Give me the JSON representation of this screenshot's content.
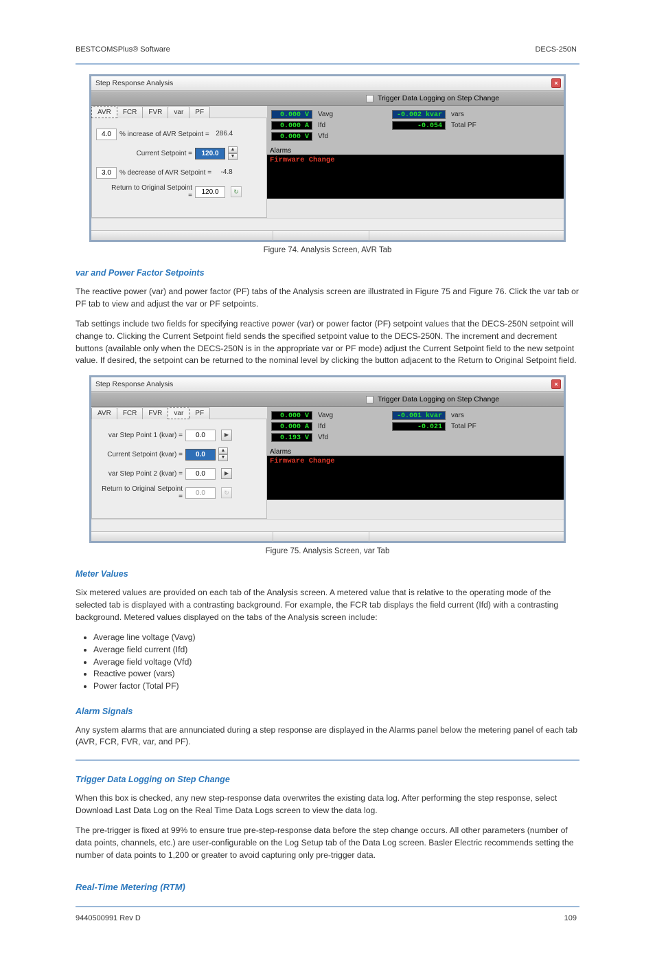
{
  "header": {
    "left": "BESTCOMSPlus® Software",
    "right": "DECS-250N"
  },
  "footer": {
    "left": "9440500991 Rev D",
    "right": "109"
  },
  "screenshot1": {
    "title": "Step Response Analysis",
    "trigger_label": "Trigger Data Logging on Step Change",
    "tabs": [
      "AVR",
      "FCR",
      "FVR",
      "var",
      "PF"
    ],
    "active_tab": "AVR",
    "row1": {
      "box": "4.0",
      "label": "% increase of AVR Setpoint =",
      "value": "286.4"
    },
    "row2": {
      "label": "Current Setpoint =",
      "value": "120.0"
    },
    "row3": {
      "box": "3.0",
      "label": "% decrease of AVR Setpoint =",
      "value": "-4.8"
    },
    "row4": {
      "label": "Return to Original Setpoint =",
      "value": "120.0"
    },
    "meters": {
      "vavg": {
        "val": "0.000 V",
        "lbl": "Vavg"
      },
      "ifd": {
        "val": "0.000 A",
        "lbl": "Ifd"
      },
      "vfd": {
        "val": "0.000 V",
        "lbl": "Vfd"
      },
      "vars": {
        "val": "-0.002 kvar",
        "lbl": "vars"
      },
      "pf": {
        "val": "-0.054",
        "lbl": "Total PF"
      }
    },
    "alarms_title": "Alarms",
    "alarm_text": "Firmware Change"
  },
  "caption1": "Figure 74. Analysis Screen, AVR Tab",
  "heading_setpoints": "var and Power Factor Setpoints",
  "para_setpoints_1": "The reactive power (var) and power factor (PF) tabs of the Analysis screen are illustrated in Figure 75 and Figure 76. Click the var tab or PF tab to view and adjust the var or PF setpoints.",
  "para_setpoints_2": "Tab settings include two fields for specifying reactive power (var) or power factor (PF) setpoint values that the DECS-250N setpoint will change to. Clicking the Current Setpoint field sends the specified setpoint value to the DECS-250N. The increment and decrement buttons (available only when the DECS-250N is in the appropriate var or PF mode) adjust the Current Setpoint field to the new setpoint value. If desired, the setpoint can be returned to the nominal level by clicking the button adjacent to the Return to Original Setpoint field.",
  "screenshot2": {
    "title": "Step Response Analysis",
    "trigger_label": "Trigger Data Logging on Step Change",
    "tabs": [
      "AVR",
      "FCR",
      "FVR",
      "var",
      "PF"
    ],
    "active_tab": "var",
    "row1": {
      "label": "var Step Point 1 (kvar) =",
      "value": "0.0"
    },
    "row2": {
      "label": "Current Setpoint (kvar) =",
      "value": "0.0"
    },
    "row3": {
      "label": "var Step Point 2 (kvar) =",
      "value": "0.0"
    },
    "row4": {
      "label": "Return to Original Setpoint =",
      "value": "0.0"
    },
    "meters": {
      "vavg": {
        "val": "0.000 V",
        "lbl": "Vavg"
      },
      "ifd": {
        "val": "0.000 A",
        "lbl": "Ifd"
      },
      "vfd": {
        "val": "0.193 V",
        "lbl": "Vfd"
      },
      "vars": {
        "val": "-0.001 kvar",
        "lbl": "vars"
      },
      "pf": {
        "val": "-0.021",
        "lbl": "Total PF"
      }
    },
    "alarms_title": "Alarms",
    "alarm_text": "Firmware Change"
  },
  "caption2": "Figure 75. Analysis Screen, var Tab",
  "heading_meter": "Meter Values",
  "para_meter": "Six metered values are provided on each tab of the Analysis screen. A metered value that is relative to the operating mode of the selected tab is displayed with a contrasting background. For example, the FCR tab displays the field current (Ifd) with a contrasting background. Metered values displayed on the tabs of the Analysis screen include:",
  "bullets": [
    "Average line voltage (Vavg)",
    "Average field current (Ifd)",
    "Average field voltage (Vfd)",
    "Reactive power (vars)",
    "Power factor (Total PF)"
  ],
  "heading_alarms": "Alarm Signals",
  "para_alarms": "Any system alarms that are annunciated during a step response are displayed in the Alarms panel below the metering panel of each tab (AVR, FCR, FVR, var, and PF).",
  "heading_trigger": "Trigger Data Logging on Step Change",
  "para_trigger1": "When this box is checked, any new step-response data overwrites the existing data log. After performing the step response, select Download Last Data Log on the Real Time Data Logs screen to view the data log.",
  "para_trigger2": "The pre-trigger is fixed at 99% to ensure true pre-step-response data before the step change occurs. All other parameters (number of data points, channels, etc.) are user-configurable on the Log Setup tab of the Data Log screen. Basler Electric recommends setting the number of data points to 1,200 or greater to avoid capturing only pre-trigger data.",
  "subheading_rtm": "Real-Time Metering (RTM)"
}
